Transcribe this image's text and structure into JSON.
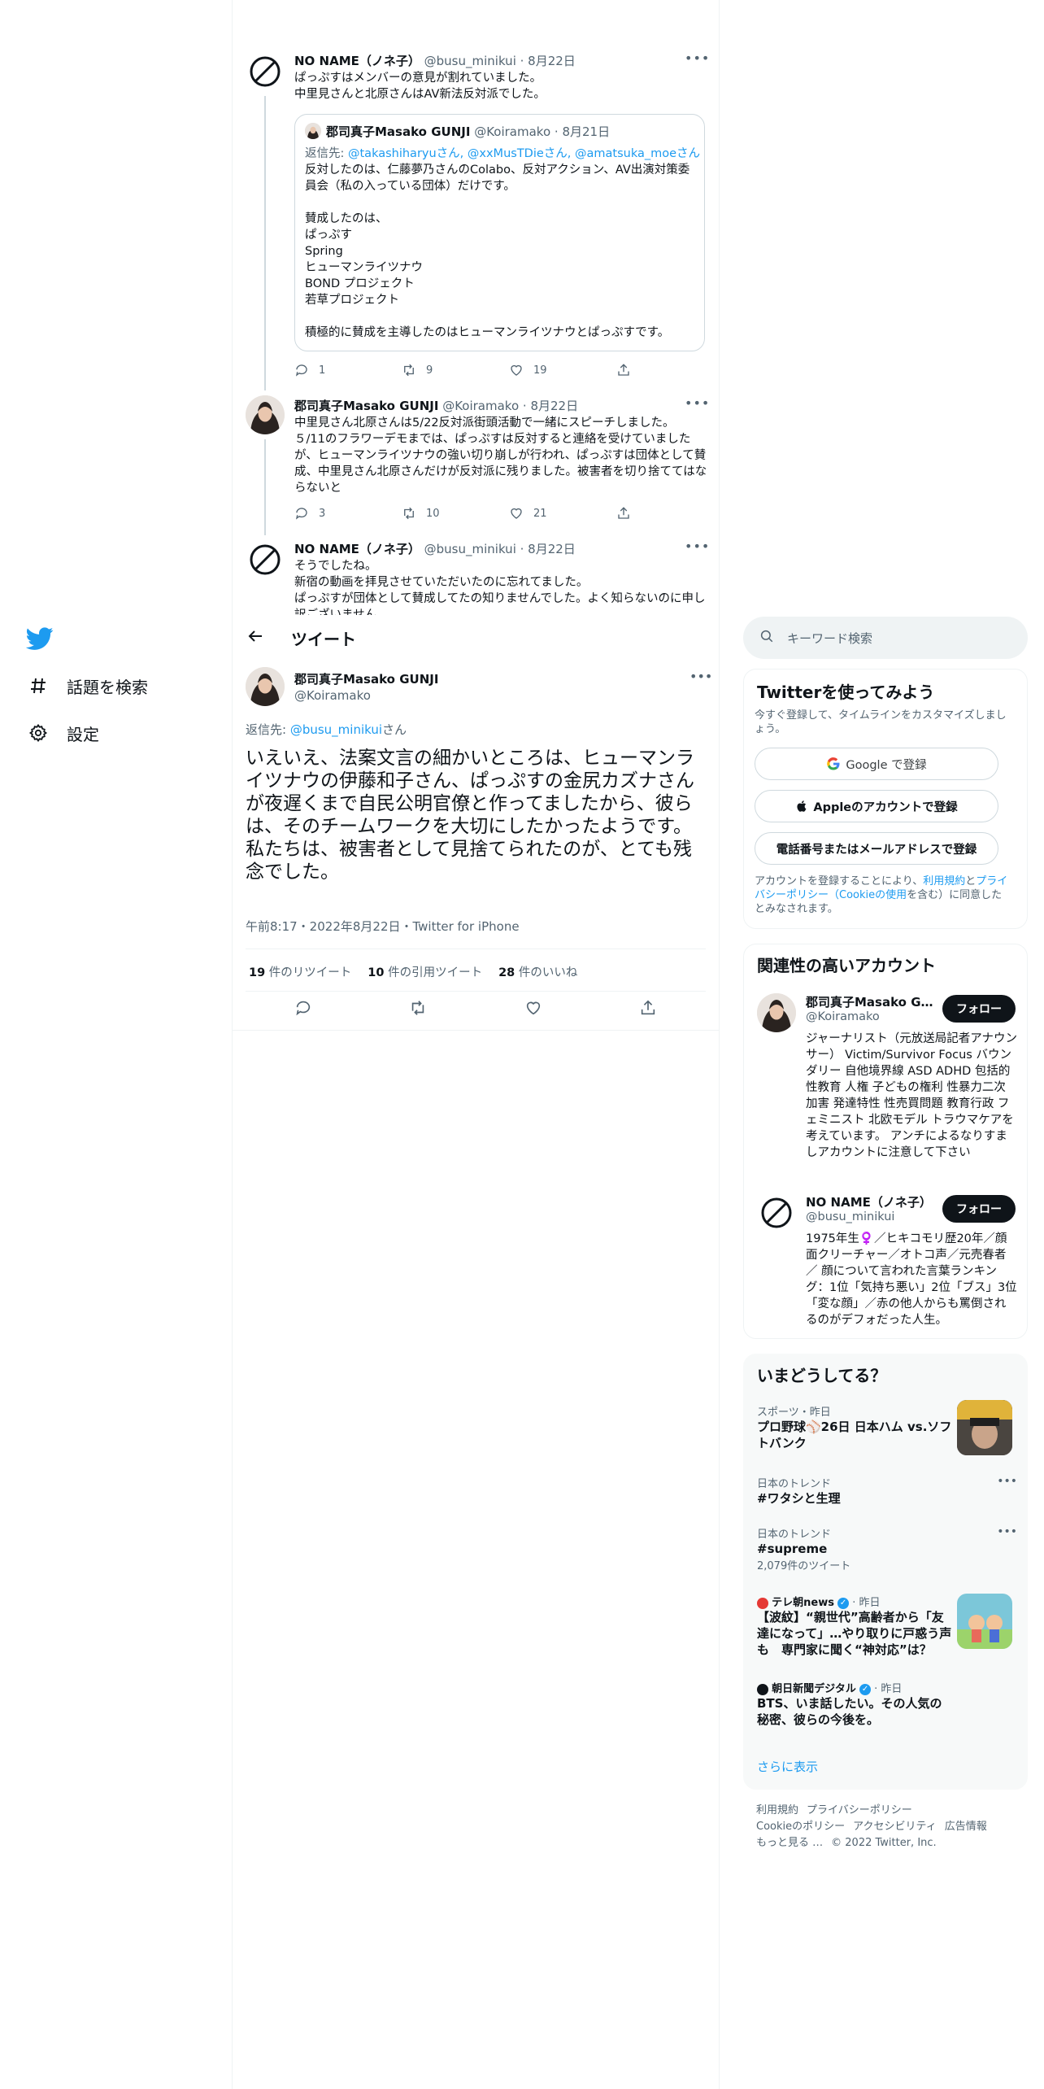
{
  "nav": {
    "items": [
      {
        "label": "話題を検索",
        "icon": "hashtag-icon"
      },
      {
        "label": "設定",
        "icon": "gear-icon"
      }
    ]
  },
  "thread": {
    "tweet1": {
      "name": "NO NAME（ノネ子）",
      "handle": "@busu_minikui",
      "date": "· 8月22日",
      "text": "ぱっぷすはメンバーの意見が割れていました。\n中里見さんと北原さんはAV新法反対派でした。",
      "quote": {
        "name": "郡司真子Masako GUNJI",
        "handle": "@Koiramako",
        "date": "· 8月21日",
        "reply_prefix": "返信先: ",
        "reply_to": "@takashiharyuさん, @xxMusTDieさん, @amatsuka_moeさん",
        "text": "反対したのは、仁藤夢乃さんのColabo、反対アクション、AV出演対策委員会（私の入っている団体）だけです。\n\n賛成したのは、\nぱっぷす\nSpring\nヒューマンライツナウ\nBOND プロジェクト\n若草プロジェクト\n\n積極的に賛成を主導したのはヒューマンライツナウとぱっぷすです。"
      },
      "replies": "1",
      "retweets": "9",
      "likes": "19"
    },
    "tweet2": {
      "name": "郡司真子Masako GUNJI",
      "handle": "@Koiramako",
      "date": "· 8月22日",
      "text": "中里見さん北原さんは5/22反対派街頭活動で一緒にスピーチしました。\n５/11のフラワーデモまでは、ぱっぷすは反対すると連絡を受けていましたが、ヒューマンライツナウの強い切り崩しが行われ、ぱっぷすは団体として賛成、中里見さん北原さんだけが反対派に残りました。被害者を切り捨ててはならないと",
      "replies": "3",
      "retweets": "10",
      "likes": "21"
    },
    "tweet3": {
      "name": "NO NAME（ノネ子）",
      "handle": "@busu_minikui",
      "date": "· 8月22日",
      "text": "そうでしたね。\n新宿の動画を拝見させていただいたのに忘れてました。\nぱっぷすが団体として賛成してたの知りませんでした。よく知らないのに申し訳ございません。"
    }
  },
  "header": {
    "title": "ツイート"
  },
  "main_tweet": {
    "name": "郡司真子Masako GUNJI",
    "handle": "@Koiramako",
    "reply_prefix": "返信先: ",
    "reply_to": "@busu_minikui",
    "reply_suffix": "さん",
    "text": "いえいえ、法案文言の細かいところは、ヒューマンライツナウの伊藤和子さん、ぱっぷすの金尻カズナさんが夜遅くまで自民公明官僚と作ってましたから、彼らは、そのチームワークを大切にしたかったようです。\n私たちは、被害者として見捨てられたのが、とても残念でした。",
    "meta": "午前8:17・2022年8月22日・Twitter for iPhone",
    "retweets_count": "19",
    "retweets_label": " 件のリツイート",
    "quotes_count": "10",
    "quotes_label": " 件の引用ツイート",
    "likes_count": "28",
    "likes_label": " 件のいいね"
  },
  "search": {
    "placeholder": "キーワード検索"
  },
  "signup": {
    "title": "Twitterを使ってみよう",
    "subtitle": "今すぐ登録して、タイムラインをカスタマイズしましょう。",
    "google": "Google で登録",
    "apple": "Appleのアカウントで登録",
    "phone": "電話番号またはメールアドレスで登録",
    "legal_a": "アカウントを登録することにより、",
    "legal_link1": "利用規約",
    "legal_b": "と",
    "legal_link2": "プライバシーポリシー（Cookieの使用",
    "legal_c": "を含む）に同意したとみなされます。"
  },
  "related": {
    "title": "関連性の高いアカウント",
    "follow_label": "フォロー",
    "accounts": [
      {
        "name": "郡司真子Masako GUNJI",
        "handle": "@Koiramako",
        "bio": "ジャーナリスト（元放送局記者アナウンサー） Victim/Survivor Focus バウンダリー 自他境界線 ASD ADHD 包括的性教育 人権 子どもの権利 性暴力二次加害 発達特性 性売買問題 教育行政 フェミニスト 北欧モデル トラウマケアを考えています。 アンチによるなりすましアカウントに注意して下さい"
      },
      {
        "name": "NO NAME（ノネ子）",
        "handle": "@busu_minikui",
        "bio": "1975年生♀️／ヒキコモリ歴20年／顔面クリーチャー／オトコ声／元売春者／ 顔について言われた言葉ランキング：1位「気持ち悪い」2位「ブス」3位「変な顔」／赤の他人からも罵倒されるのがデフォだった人生。"
      }
    ]
  },
  "trends": {
    "title": "いまどうしてる？",
    "items": [
      {
        "meta": "スポーツ・昨日",
        "title": "プロ野球⚾️26日 日本ハム vs.ソフトバンク"
      },
      {
        "meta": "日本のトレンド",
        "title": "#ワタシと生理"
      },
      {
        "meta": "日本のトレンド",
        "title": "#supreme",
        "count": "2,079件のツイート"
      },
      {
        "source": "テレ朝news",
        "time": "· 昨日",
        "title": "【波紋】“親世代”高齢者から「友達になって」…やり取りに戸惑う声も　専門家に聞く“神対応”は？"
      },
      {
        "source": "朝日新聞デジタル",
        "time": "· 昨日",
        "title": "BTS、いま話したい。その人気の秘密、彼らの今後を。"
      }
    ],
    "show_more": "さらに表示"
  },
  "footer": {
    "links": [
      "利用規約",
      "プライバシーポリシー",
      "Cookieのポリシー",
      "アクセシビリティ",
      "広告情報",
      "もっと見る …"
    ],
    "copyright": "© 2022 Twitter, Inc."
  }
}
